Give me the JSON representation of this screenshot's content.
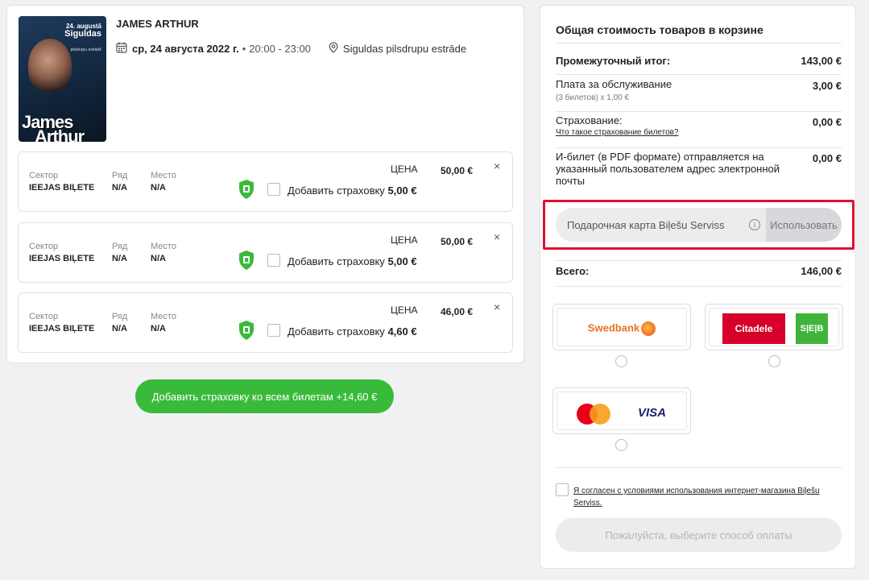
{
  "event": {
    "title": "JAMES ARTHUR",
    "date": "ср, 24 августа 2022 г.",
    "time": "20:00 - 23:00",
    "venue": "Siguldas pilsdrupu estrāde",
    "poster": {
      "date_text": "24. augustā",
      "venue_text": "Siguldas",
      "venue_sub": "pilsdrupu estrādē",
      "name_line1": "James",
      "name_line2": "Arthur"
    }
  },
  "ticket_labels": {
    "sector": "Сектор",
    "row": "Ряд",
    "seat": "Место",
    "price": "ЦЕНА",
    "add_insurance": "Добавить страховку",
    "close": "×"
  },
  "tickets": [
    {
      "sector": "IEEJAS BIĻETE",
      "row": "N/A",
      "seat": "N/A",
      "price": "50,00 €",
      "insurance": "5,00 €"
    },
    {
      "sector": "IEEJAS BIĻETE",
      "row": "N/A",
      "seat": "N/A",
      "price": "50,00 €",
      "insurance": "5,00 €"
    },
    {
      "sector": "IEEJAS BIĻETE",
      "row": "N/A",
      "seat": "N/A",
      "price": "46,00 €",
      "insurance": "4,60 €"
    }
  ],
  "add_all_button": "Добавить страховку ко всем билетам +14,60 €",
  "summary": {
    "title": "Общая стоимость товаров в корзине",
    "subtotal_label": "Промежуточный итог:",
    "subtotal_value": "143,00 €",
    "service_label": "Плата за обслуживание",
    "service_sub": "(3 билетов) x 1,00 €",
    "service_value": "3,00 €",
    "insurance_label": "Страхование:",
    "insurance_link": "Что такое страхование билетов?",
    "insurance_value": "0,00 €",
    "eticket_label": "И-билет (в PDF формате) отправляется на указанный пользователем адрес электронной почты",
    "eticket_value": "0,00 €",
    "total_label": "Всего:",
    "total_value": "146,00 €"
  },
  "gift_card": {
    "placeholder": "Подарочная карта Biļešu Serviss",
    "info": "i",
    "button": "Использовать"
  },
  "payment": {
    "swedbank": "Swedbank",
    "citadele": "Citadele",
    "seb": "S|E|B",
    "visa": "VISA"
  },
  "agree_text": "Я согласен с условиями использования интернет-магазина Biļešu Serviss.",
  "pay_button": "Пожалуйста, выберите способ оплаты",
  "colors": {
    "accent_green": "#3aba3a",
    "highlight_red": "#e0102c",
    "citadele_red": "#d6002a",
    "seb_green": "#41b33b",
    "swedbank_orange": "#ee7023"
  }
}
